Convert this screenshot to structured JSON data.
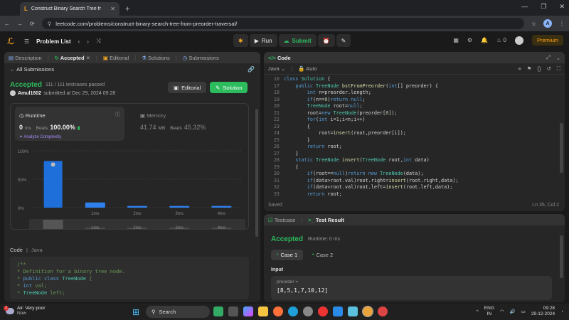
{
  "browser": {
    "tab_title": "Construct Binary Search Tree fr",
    "new_tab": "+",
    "url": "leetcode.com/problems/construct-binary-search-tree-from-preorder-traversal/",
    "profile_initial": "A"
  },
  "nav": {
    "problem_list": "Problem List",
    "run": "Run",
    "submit": "Submit",
    "streak": "0",
    "premium": "Premium"
  },
  "left_tabs": [
    {
      "label": "Description",
      "active": false
    },
    {
      "label": "Accepted",
      "active": true
    },
    {
      "label": "Editorial",
      "active": false
    },
    {
      "label": "Solutions",
      "active": false
    },
    {
      "label": "Submissions",
      "active": false
    }
  ],
  "submission": {
    "all_submissions": "All Submissions",
    "status": "Accepted",
    "passed": "111 / 111 testcases passed",
    "user": "Amul1602",
    "submitted_at": "submitted at Dec 29, 2024 09:28",
    "editorial_btn": "Editorial",
    "solution_btn": "Solution"
  },
  "runtime": {
    "label": "Runtime",
    "value": "0",
    "unit": "ms",
    "beats_label": "Beats",
    "beats": "100.00%",
    "analyze": "Analyze Complexity"
  },
  "memory": {
    "label": "Memory",
    "value": "41.74",
    "unit": "MB",
    "beats_label": "Beats",
    "beats": "45.32%"
  },
  "chart_data": {
    "type": "bar",
    "yticks": [
      "100%",
      "50%",
      "0%"
    ],
    "categories": [
      "0ms",
      "1ms",
      "2ms",
      "3ms",
      "4ms"
    ],
    "xlabels": [
      "",
      "1ms",
      "2ms",
      "3ms",
      "4ms"
    ],
    "values": [
      82,
      9,
      3,
      3,
      3
    ],
    "ylim": [
      0,
      100
    ],
    "minimap_labels": [
      "1ms",
      "2ms",
      "3ms",
      "4ms"
    ],
    "highlight_color": "#1e6fd9",
    "bar_color": "#2f80ed"
  },
  "code_section": {
    "label": "Code",
    "lang": "Java",
    "lines": [
      "/**",
      " * Definition for a binary tree node.",
      " * public class TreeNode {",
      " *     int val;",
      " *     TreeNode left;"
    ]
  },
  "editor": {
    "title": "Code",
    "language": "Java",
    "mode": "Auto",
    "start_line": 16,
    "lines": [
      "class Solution {",
      "    public TreeNode bstFromPreorder(int[] preorder) {",
      "        int n=preorder.length;",
      "        if(n==0)return null;",
      "        TreeNode root=null;",
      "        root=new TreeNode(preorder[0]);",
      "        for(int i=1;i<n;i++)",
      "        {",
      "            root=insert(root,preorder[i]);",
      "        }",
      "        return root;",
      "    }",
      "    static TreeNode insert(TreeNode root,int data)",
      "    {",
      "        if(root==null)return new TreeNode(data);",
      "        if(data>root.val)root.right=insert(root.right,data);",
      "        if(data<root.val)root.left=insert(root.left,data);",
      "        return root;"
    ],
    "saved": "Saved",
    "cursor": "Ln 35, Col 2"
  },
  "test": {
    "tab1": "Testcase",
    "tab2": "Test Result",
    "status": "Accepted",
    "runtime": "Runtime: 0 ms",
    "case1": "Case 1",
    "case2": "Case 2",
    "input_label": "Input",
    "param": "preorder =",
    "value": "[8,5,1,7,10,12]"
  },
  "taskbar": {
    "weather_title": "Air: Very poor",
    "weather_sub": "Now",
    "weather_badge": "1",
    "search": "Search",
    "lang1": "ENG",
    "lang2": "IN",
    "time": "09:28",
    "date": "29-12-2024"
  }
}
